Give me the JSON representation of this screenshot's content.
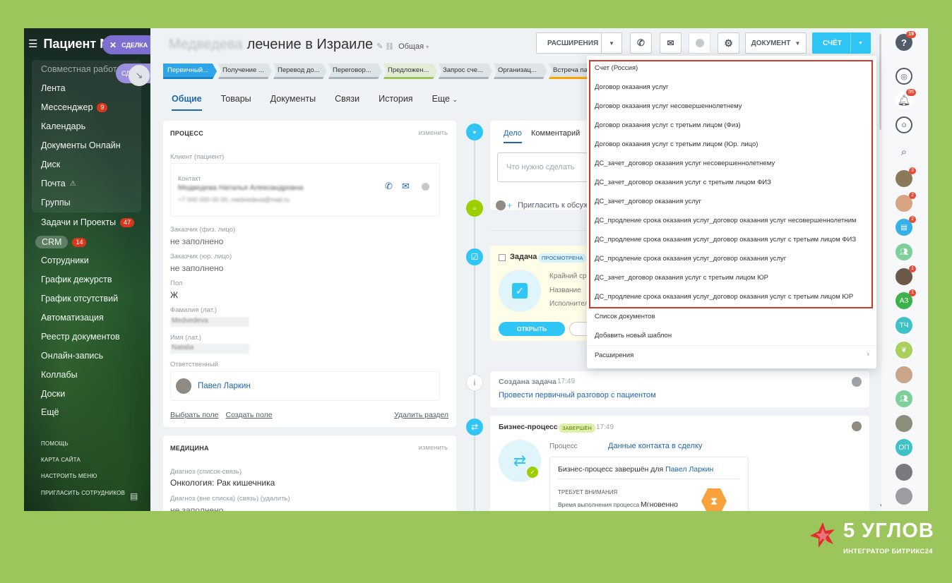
{
  "sidebar": {
    "portal_title": "Пациент М",
    "group_items": [
      "Совместная работа",
      "Лента",
      "Мессенджер",
      "Календарь",
      "Документы Онлайн",
      "Диск",
      "Почта",
      "Группы"
    ],
    "messenger_badge": "9",
    "items": [
      "Задачи и Проекты",
      "CRM",
      "Сотрудники",
      "График дежурств",
      "График отсутствий",
      "Автоматизация",
      "Реестр документов",
      "Онлайн-запись",
      "Коллабы",
      "Доски",
      "Ещё"
    ],
    "tasks_badge": "47",
    "crm_badge": "14",
    "footer": [
      "ПОМОЩЬ",
      "КАРТА САЙТА",
      "НАСТРОИТЬ МЕНЮ",
      "ПРИГЛАСИТЬ СОТРУДНИКОВ"
    ]
  },
  "slider": {
    "close_label": "СДЕЛКА",
    "second_label": "СДЕ"
  },
  "header": {
    "title_blurred": "Медведева",
    "title": "лечение в Израиле",
    "category": "Общая",
    "extensions_label": "РАСШИРЕНИЯ",
    "document_label": "ДОКУМЕНТ",
    "invoice_label": "СЧЁТ"
  },
  "stages": [
    "Первичный...",
    "Получение ...",
    "Перевод до...",
    "Переговор...",
    "Предложен...",
    "Запрос сче...",
    "Организац...",
    "Встреча па..."
  ],
  "tabs": [
    "Общие",
    "Товары",
    "Документы",
    "Связи",
    "История",
    "Еще"
  ],
  "process_card": {
    "header": "ПРОЦЕСС",
    "edit": "изменить",
    "client_label": "Клиент (пациент)",
    "contact_label": "Контакт",
    "contact_name_blurred": "Медведева Наталья Александровна",
    "contact_phone_blurred": "+7 000 000 00 00, medvedeva@mail.ru",
    "customer_person_label": "Заказчик (физ. лицо)",
    "customer_person_value": "не заполнено",
    "customer_org_label": "Заказчик (юр. лицо)",
    "customer_org_value": "не заполнено",
    "gender_label": "Пол",
    "gender_value": "Ж",
    "lastname_label": "Фамилия (лат.)",
    "lastname_value": "Medvedeva",
    "firstname_label": "Имя (лат.)",
    "firstname_value": "Natalia",
    "responsible_label": "Ответственный",
    "responsible_name": "Павел Ларкин",
    "select_field": "Выбрать поле",
    "create_field": "Создать поле",
    "delete_section": "Удалить раздел"
  },
  "medicine_card": {
    "header": "МЕДИЦИНА",
    "edit": "изменить",
    "diag_label": "Диагноз (список-связь)",
    "diag_value": "Онкология: Рак кишечника",
    "diag2_label": "Диагноз (вне списка) (связь) (удалить)",
    "diag2_value": "не заполнено"
  },
  "timeline": {
    "tab_deal": "Дело",
    "tab_comment": "Комментарий",
    "input_placeholder": "Что нужно сделать",
    "invite": "Пригласить к обсуж",
    "task_title": "Задача",
    "task_badge": "ПРОСМОТРЕНА",
    "task_deadline": "Крайний ср",
    "task_name": "Название",
    "task_executor": "Исполнител",
    "open_button": "ОТКРЫТЬ",
    "created_title": "Создана задача",
    "created_time": "17:49",
    "created_link": "Провести первичный разговор с пациентом",
    "bp_title": "Бизнес-процесс",
    "bp_badge": "ЗАВЕРШЁН",
    "bp_time": "17:49",
    "bp_process_label": "Процесс",
    "bp_process_value": "Данные контакта в сделку",
    "bp_done": "Бизнес-процесс завершён для",
    "bp_done_name": "Павел Ларкин",
    "bp_attention": "ТРЕБУЕТ ВНИМАНИЯ",
    "bp_exec_label": "Время выполнения процесса",
    "bp_exec_value": "Мгновенно"
  },
  "dropdown": {
    "highlighted_items": [
      "Счет (Россия)",
      "Договор оказания услуг",
      "Договор оказания услуг несовершеннолетнему",
      "Договор оказания услуг с третьим лицом (Физ)",
      "Договор оказания услуг с третьим лицом (Юр. лицо)",
      "ДС_зачет_договор оказания услуг несовершеннолетнему",
      "ДС_зачет_договор оказания услуг с третьим лицом ФИЗ",
      "ДС_зачет_договор оказания услуг",
      "ДС_продление срока оказания услуг_договор оказания услуг несовершеннолетним",
      "ДС_продление срока оказания услуг_договор оказания услуг с третьим лицом ФИЗ",
      "ДС_продление срока оказания услуг_договор оказания услуг",
      "ДС_зачет_договор оказания услуг с третьим лицом ЮР",
      "ДС_продление срока оказания услуг_договор оказания услуг с третьим лицом ЮР"
    ],
    "doc_list": "Список документов",
    "add_template": "Добавить новый шаблон",
    "extensions": "Расширения"
  },
  "right_panel": {
    "help_badge": "19",
    "bell_badge": "95",
    "avatars": [
      {
        "badge": "3",
        "color": "#8a7a5a",
        "initials": ""
      },
      {
        "badge": "2",
        "color": "#d9a580",
        "initials": ""
      },
      {
        "badge": "2",
        "color": "#35b0e8",
        "initials": ""
      },
      {
        "badge": "",
        "color": "#7fcf9a",
        "initials": ""
      },
      {
        "badge": "1",
        "color": "#6b5a4a",
        "initials": ""
      },
      {
        "badge": "1",
        "color": "#3cb34a",
        "initials": "АЗ"
      },
      {
        "badge": "",
        "color": "#3fc2c6",
        "initials": "ТЧ"
      },
      {
        "badge": "",
        "color": "#a8d05a",
        "initials": ""
      },
      {
        "badge": "",
        "color": "#c9a58a",
        "initials": ""
      },
      {
        "badge": "",
        "color": "#7fcf9a",
        "initials": ""
      },
      {
        "badge": "",
        "color": "#8a8f7a",
        "initials": ""
      },
      {
        "badge": "",
        "color": "#3fc2c6",
        "initials": "ОП"
      },
      {
        "badge": "",
        "color": "#777b80",
        "initials": ""
      },
      {
        "badge": "",
        "color": "#9a9ea3",
        "initials": ""
      }
    ]
  },
  "logo": {
    "text": "5 УГЛОВ",
    "subtitle": "ИНТЕГРАТОР БИТРИКС24"
  }
}
